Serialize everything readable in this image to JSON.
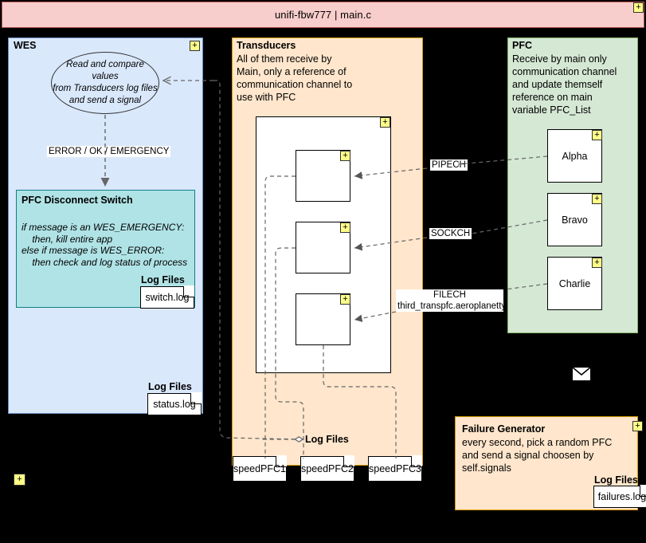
{
  "window": {
    "title": "unifi-fbw777 | main.c",
    "expand_badge": "+"
  },
  "lanes": {
    "wes": {
      "title": "WES",
      "badge": "+",
      "ellipse": [
        "Read and compare values",
        "from Transducers log files",
        "and send a signal"
      ],
      "signal_label": "ERROR / OK / EMERGENCY",
      "switch": {
        "title": "PFC Disconnect Switch",
        "lines": [
          "if message is an WES_EMERGENCY:",
          "    then, kill entire app",
          "else if message is WES_ERROR:",
          "    then check and log status of process"
        ],
        "log_files_label": "Log Files",
        "log_file": "switch.log"
      },
      "log_files_label": "Log Files",
      "log_file": "status.log"
    },
    "transducers": {
      "title": "Transducers",
      "description": [
        "All of them receive by",
        "Main, only a reference of",
        "communication channel to",
        "use with PFC"
      ],
      "group_badge": "+",
      "nodes": [
        {
          "badge": "+",
          "label": ""
        },
        {
          "badge": "+",
          "label": ""
        },
        {
          "badge": "+",
          "label": ""
        }
      ],
      "log_files_label": "Log Files",
      "log_files": [
        "speedPFC1",
        "speedPFC2",
        "speedPFC3"
      ]
    },
    "pfc": {
      "title": "PFC",
      "description": [
        "Receive by main only",
        "communication channel",
        "and update themself",
        "reference on main",
        "variable PFC_List"
      ],
      "nodes": [
        {
          "badge": "+",
          "label": "Alpha"
        },
        {
          "badge": "+",
          "label": "Bravo"
        },
        {
          "badge": "+",
          "label": "Charlie"
        }
      ]
    },
    "failure_generator": {
      "title": "Failure Generator",
      "badge": "+",
      "description": [
        "every second, pick a random PFC",
        "and send a signal choosen by",
        "self.signals"
      ],
      "log_files_label": "Log Files",
      "log_file": "failures.log"
    }
  },
  "channels": [
    {
      "name": "PIPECH",
      "detail": ""
    },
    {
      "name": "SOCKCH",
      "detail": ""
    },
    {
      "name": "FILECH",
      "detail": "third_transpfc.aeroplanetty"
    }
  ],
  "misc": {
    "mail_icon": "mail-icon",
    "canvas_badge": "+"
  },
  "colors": {
    "title_bg": "#f8cecc",
    "title_border": "#b85450",
    "wes_bg": "#dae8fc",
    "wes_border": "#6c8ebf",
    "transducers_bg": "#ffe6cc",
    "transducers_border": "#d79b00",
    "pfc_bg": "#d5e8d4",
    "pfc_border": "#82b366",
    "teal_bg": "#b0e3e6",
    "teal_border": "#0e8088",
    "badge_bg": "#ffff88",
    "canvas_bg": "#000000"
  }
}
